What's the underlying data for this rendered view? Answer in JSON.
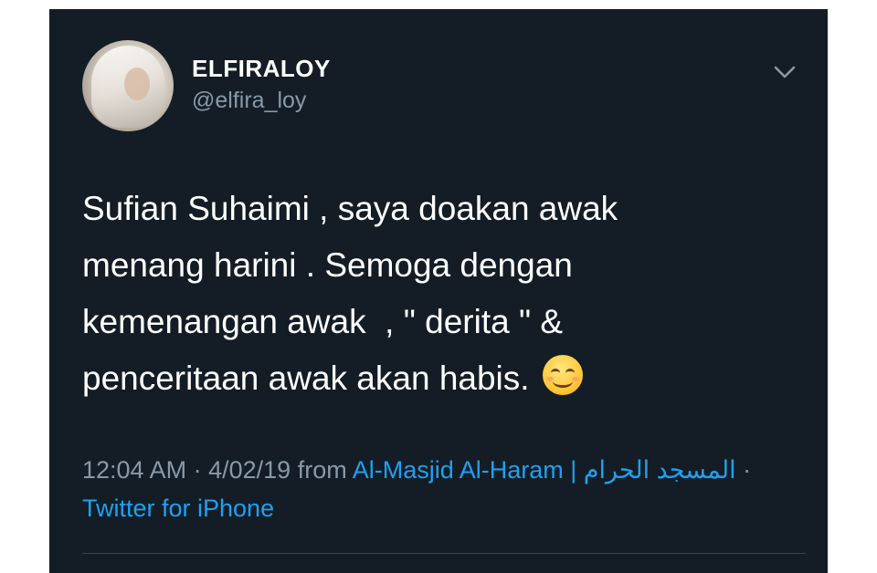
{
  "user": {
    "display_name": "ELFIRALOY",
    "handle": "@elfira_loy"
  },
  "tweet": {
    "lines": [
      "Sufian Suhaimi , saya doakan awak",
      "menang harini . Semoga dengan",
      "kemenangan awak  , \" derita \" &",
      "penceritaan awak akan habis."
    ],
    "emoji": "smiling-face-with-smiling-eyes"
  },
  "meta": {
    "time": "12:04 AM",
    "separator": "·",
    "date": "4/02/19",
    "from_label": "from",
    "location": "Al-Masjid Al-Haram | المسجد الحرام",
    "source": "Twitter for iPhone"
  },
  "colors": {
    "background": "#141d26",
    "text": "#ffffff",
    "muted": "#8899a6",
    "link": "#1da1f2"
  }
}
